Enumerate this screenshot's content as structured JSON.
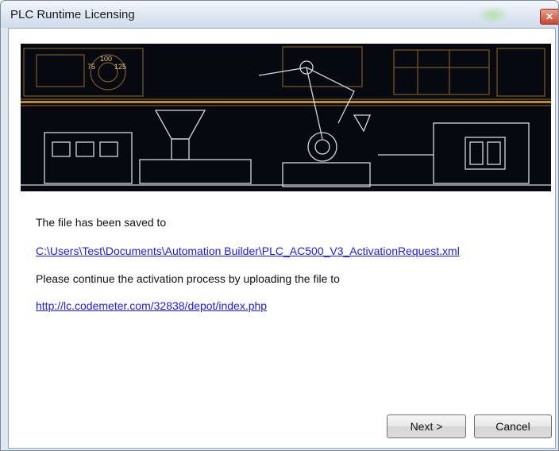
{
  "window": {
    "title": "PLC Runtime Licensing",
    "close_symbol": "✕"
  },
  "banner": {
    "numbers": [
      "75",
      "100",
      "125"
    ]
  },
  "content": {
    "saved_text": "The file has been saved to",
    "file_path": "C:\\Users\\Test\\Documents\\Automation Builder\\PLC_AC500_V3_ActivationRequest.xml",
    "continue_text": "Please continue the activation process by uploading the file to",
    "upload_url": "http://lc.codemeter.com/32838/depot/index.php"
  },
  "buttons": {
    "next": "Next >",
    "cancel": "Cancel"
  },
  "colors": {
    "link": "#1a1aee",
    "banner_lines": "#d9a23a",
    "banner_bg": "#060a10"
  }
}
